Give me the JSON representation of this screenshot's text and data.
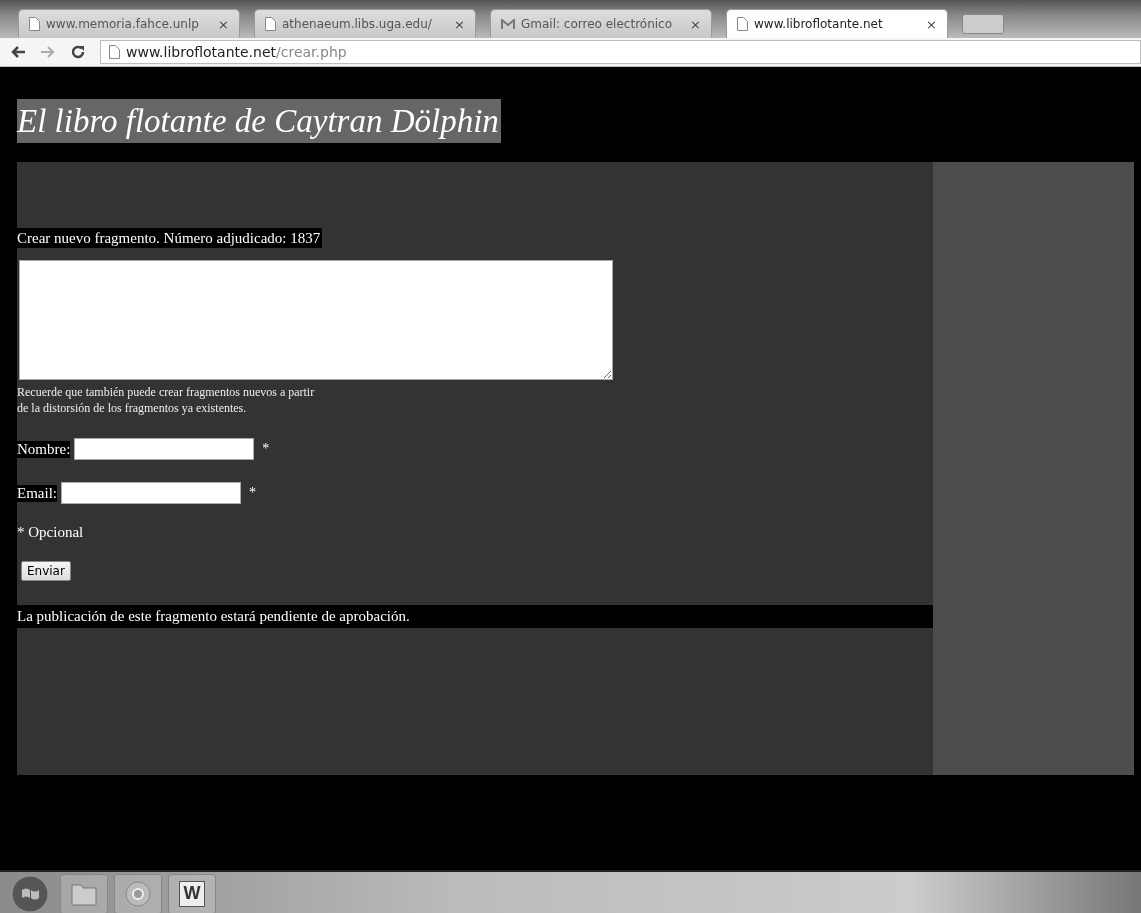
{
  "browser": {
    "tabs": [
      {
        "title": "www.memoria.fahce.unlp",
        "kind": "page",
        "selected": false
      },
      {
        "title": "athenaeum.libs.uga.edu/",
        "kind": "page",
        "selected": false
      },
      {
        "title": "Gmail: correo electrónico",
        "kind": "mail",
        "selected": false
      },
      {
        "title": "www.libroflotante.net",
        "kind": "page",
        "selected": true
      }
    ],
    "close_glyph": "×",
    "address": {
      "host": "www.libroflotante.net",
      "path": "/crear.php"
    }
  },
  "page": {
    "site_title": "El libro flotante de Caytran Dölphin",
    "heading": "Crear nuevo fragmento. Número adjudicado: 1837",
    "hint_lines": [
      "Recuerde que también puede crear fragmentos nuevos a partir",
      "de la distorsión de los fragmentos ya existentes."
    ],
    "fields": [
      {
        "label": "Nombre:",
        "mark": "*"
      },
      {
        "label": "Email:",
        "mark": "*"
      }
    ],
    "legend": "* Opcional",
    "submit": "Enviar",
    "notice": "La publicación de este fragmento estará pendiente de aprobación."
  },
  "taskbar": {
    "items": [
      {
        "kind": "start"
      },
      {
        "kind": "folder"
      },
      {
        "kind": "browser"
      },
      {
        "kind": "word",
        "glyph": "W"
      }
    ]
  }
}
